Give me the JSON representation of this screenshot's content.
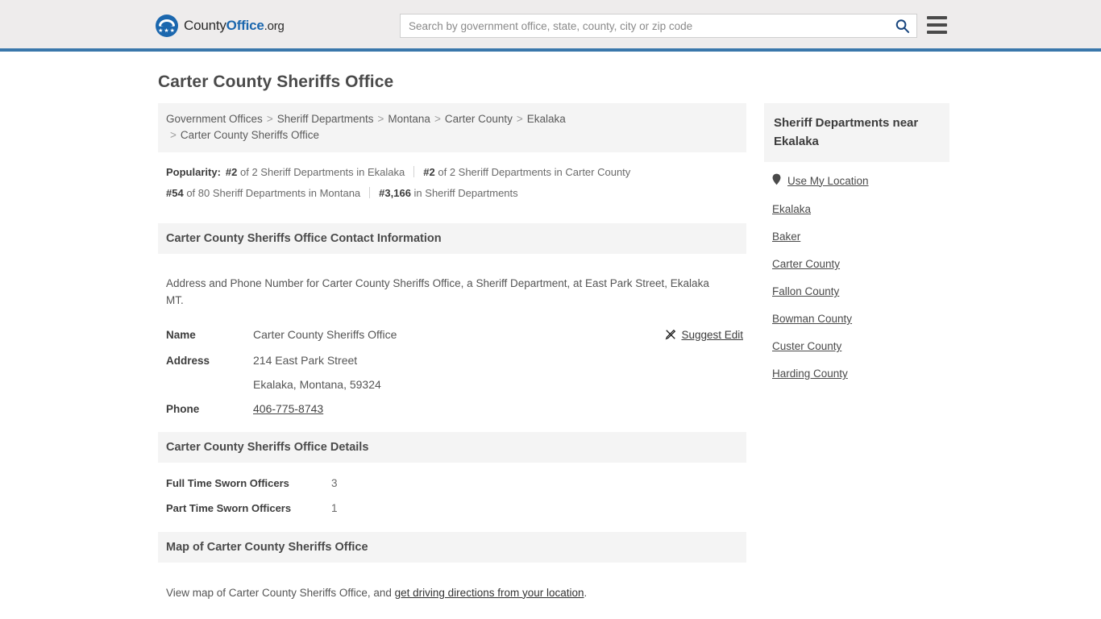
{
  "header": {
    "logo": {
      "part1": "County",
      "part2": "Office",
      "part3": ".org",
      "icon": "eagle-shield-logo"
    },
    "search": {
      "placeholder": "Search by government office, state, county, city or zip code",
      "value": "",
      "icon": "search-icon"
    },
    "menu_icon": "hamburger-menu-icon",
    "accent_color": "#3a77ab"
  },
  "page": {
    "title": "Carter County Sheriffs Office"
  },
  "breadcrumb": {
    "separator": ">",
    "items": [
      {
        "label": "Government Offices",
        "link": true
      },
      {
        "label": "Sheriff Departments",
        "link": true
      },
      {
        "label": "Montana",
        "link": true
      },
      {
        "label": "Carter County",
        "link": true
      },
      {
        "label": "Ekalaka",
        "link": true
      },
      {
        "label": "Carter County Sheriffs Office",
        "link": false
      }
    ]
  },
  "popularity": {
    "label": "Popularity:",
    "items": [
      {
        "rank": "#2",
        "text": "of 2 Sheriff Departments in Ekalaka"
      },
      {
        "rank": "#2",
        "text": "of 2 Sheriff Departments in Carter County"
      },
      {
        "rank": "#54",
        "text": "of 80 Sheriff Departments in Montana"
      },
      {
        "rank": "#3,166",
        "text": "in Sheriff Departments"
      }
    ]
  },
  "contact": {
    "heading": "Carter County Sheriffs Office Contact Information",
    "description": "Address and Phone Number for Carter County Sheriffs Office, a Sheriff Department, at East Park Street, Ekalaka MT.",
    "rows": [
      {
        "key": "Name",
        "value": "Carter County Sheriffs Office",
        "type": "text"
      },
      {
        "key": "Address",
        "value": "214 East Park Street",
        "type": "text"
      },
      {
        "key": "",
        "value": "Ekalaka, Montana, 59324",
        "type": "text"
      },
      {
        "key": "Phone",
        "value": "406-775-8743",
        "type": "link"
      }
    ],
    "suggest_edit": {
      "label": "Suggest Edit",
      "icon": "edit-pencil-icon"
    }
  },
  "details": {
    "heading": "Carter County Sheriffs Office Details",
    "rows": [
      {
        "key": "Full Time Sworn Officers",
        "value": "3"
      },
      {
        "key": "Part Time Sworn Officers",
        "value": "1"
      }
    ]
  },
  "map": {
    "heading": "Map of Carter County Sheriffs Office",
    "text_before": "View map of Carter County Sheriffs Office, and ",
    "link_text": "get driving directions from your location",
    "text_after": "."
  },
  "sidebar": {
    "heading": "Sheriff Departments near Ekalaka",
    "use_my_location": {
      "label": "Use My Location",
      "icon": "map-pin-icon"
    },
    "items": [
      {
        "label": "Ekalaka"
      },
      {
        "label": "Baker"
      },
      {
        "label": "Carter County"
      },
      {
        "label": "Fallon County"
      },
      {
        "label": "Bowman County"
      },
      {
        "label": "Custer County"
      },
      {
        "label": "Harding County"
      }
    ]
  }
}
